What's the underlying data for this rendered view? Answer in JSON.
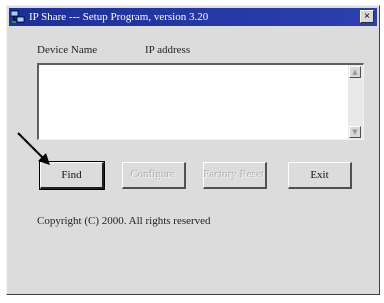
{
  "window": {
    "title": "IP Share --- Setup Program, version 3.20",
    "close_label": "×"
  },
  "list": {
    "headers": {
      "device_name": "Device Name",
      "ip_address": "IP address"
    },
    "rows": [],
    "scroll_up": "▲",
    "scroll_down": "▼"
  },
  "buttons": {
    "find": "Find",
    "configure": "Configure",
    "factory_reset": "Factory Reset",
    "exit": "Exit"
  },
  "copyright": "Copyright (C) 2000.  All rights reserved",
  "colors": {
    "titlebar": "#1c2f9a",
    "window": "#dcdcdc"
  }
}
